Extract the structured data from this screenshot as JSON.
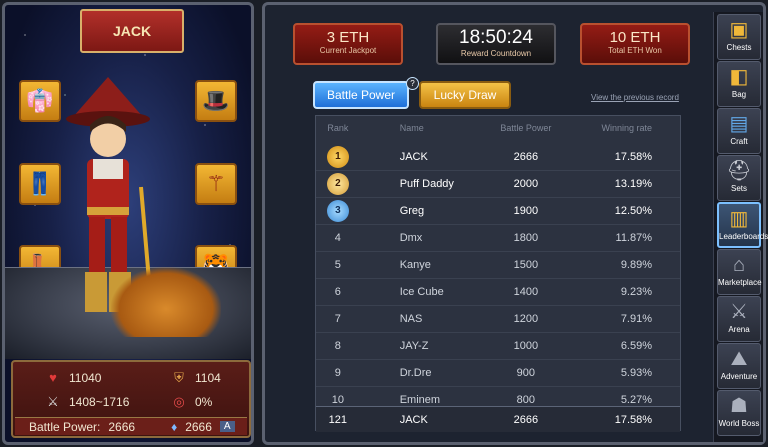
{
  "character": {
    "name": "JACK",
    "hp": "11040",
    "defense": "1104",
    "attack": "1408~1716",
    "crit": "0%",
    "battle_power_label": "Battle Power:",
    "battle_power": "2666",
    "gem_value": "2666",
    "rank_badge": "A"
  },
  "counters": {
    "jackpot": {
      "value": "3 ETH",
      "label": "Current Jackpot"
    },
    "countdown": {
      "value": "18:50:24",
      "label": "Reward Countdown"
    },
    "total": {
      "value": "10 ETH",
      "label": "Total ETH Won"
    }
  },
  "tabs": {
    "battle": "Battle Power",
    "lucky": "Lucky Draw",
    "help": "?"
  },
  "previous_record_link": "View the previous record",
  "leaderboard": {
    "headers": {
      "rank": "Rank",
      "name": "Name",
      "bp": "Battle Power",
      "wr": "Winning rate"
    },
    "rows": [
      {
        "rank": "1",
        "name": "JACK",
        "bp": "2666",
        "wr": "17.58%"
      },
      {
        "rank": "2",
        "name": "Puff Daddy",
        "bp": "2000",
        "wr": "13.19%"
      },
      {
        "rank": "3",
        "name": "Greg",
        "bp": "1900",
        "wr": "12.50%"
      },
      {
        "rank": "4",
        "name": "Dmx",
        "bp": "1800",
        "wr": "11.87%"
      },
      {
        "rank": "5",
        "name": "Kanye",
        "bp": "1500",
        "wr": "9.89%"
      },
      {
        "rank": "6",
        "name": "Ice Cube",
        "bp": "1400",
        "wr": "9.23%"
      },
      {
        "rank": "7",
        "name": "NAS",
        "bp": "1200",
        "wr": "7.91%"
      },
      {
        "rank": "8",
        "name": "JAY-Z",
        "bp": "1000",
        "wr": "6.59%"
      },
      {
        "rank": "9",
        "name": "Dr.Dre",
        "bp": "900",
        "wr": "5.93%"
      },
      {
        "rank": "10",
        "name": "Eminem",
        "bp": "800",
        "wr": "5.27%"
      }
    ],
    "my_row": {
      "rank": "121",
      "name": "JACK",
      "bp": "2666",
      "wr": "17.58%"
    }
  },
  "sidebar": {
    "items": [
      {
        "label": "Chests",
        "icon": "chest-icon"
      },
      {
        "label": "Bag",
        "icon": "bag-icon"
      },
      {
        "label": "Craft",
        "icon": "craft-book-icon"
      },
      {
        "label": "Sets",
        "icon": "helmet-icon"
      },
      {
        "label": "Leaderboards",
        "icon": "trophy-icon"
      },
      {
        "label": "Marketplace",
        "icon": "market-icon"
      },
      {
        "label": "Arena",
        "icon": "arena-icon"
      },
      {
        "label": "Adventure",
        "icon": "adventure-icon"
      },
      {
        "label": "World Boss",
        "icon": "boss-icon"
      }
    ],
    "active": "Leaderboards"
  },
  "colors": {
    "accent_blue": "#1e6fd8",
    "accent_gold": "#c98410",
    "counter_red": "#941c15"
  }
}
